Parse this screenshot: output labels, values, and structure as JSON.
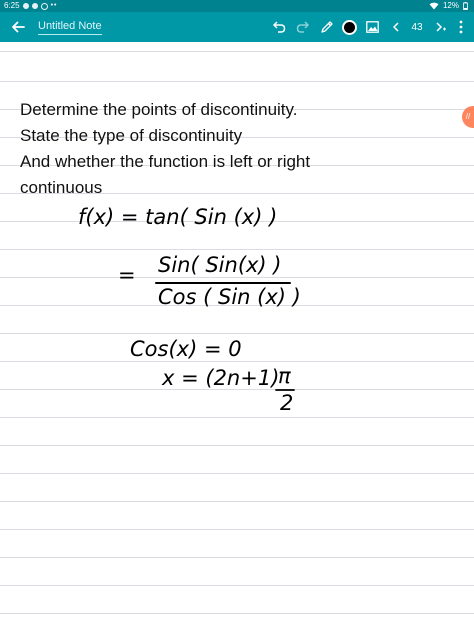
{
  "status": {
    "time": "6:25",
    "battery": "12%"
  },
  "toolbar": {
    "title": "Untitled Note",
    "page_number": "43",
    "pen_color": "#000000",
    "icons": [
      "back-arrow-icon",
      "undo-icon",
      "redo-icon",
      "pen-icon",
      "color-swatch",
      "image-icon",
      "prev-page-icon",
      "next-page-icon"
    ]
  },
  "note": {
    "typed_lines": [
      "Determine the points of discontinuity.",
      "State the type of discontinuity",
      "And whether the function is left or right",
      "continuous"
    ],
    "handwriting": {
      "line1": "f(x) = tan( Sin (x) )",
      "eq_sign": "=",
      "numerator": "Sin( Sin(x) )",
      "denominator": "Cos ( Sin (x) )",
      "line3": "Cos(x) = 0",
      "line4": "x = (2n+1)",
      "pi": "π",
      "two": "2"
    }
  },
  "colors": {
    "toolbar": "#0097a7",
    "statusbar": "#00838f",
    "ruled_line": "#d9dce0",
    "side_tab": "#ff7043"
  }
}
